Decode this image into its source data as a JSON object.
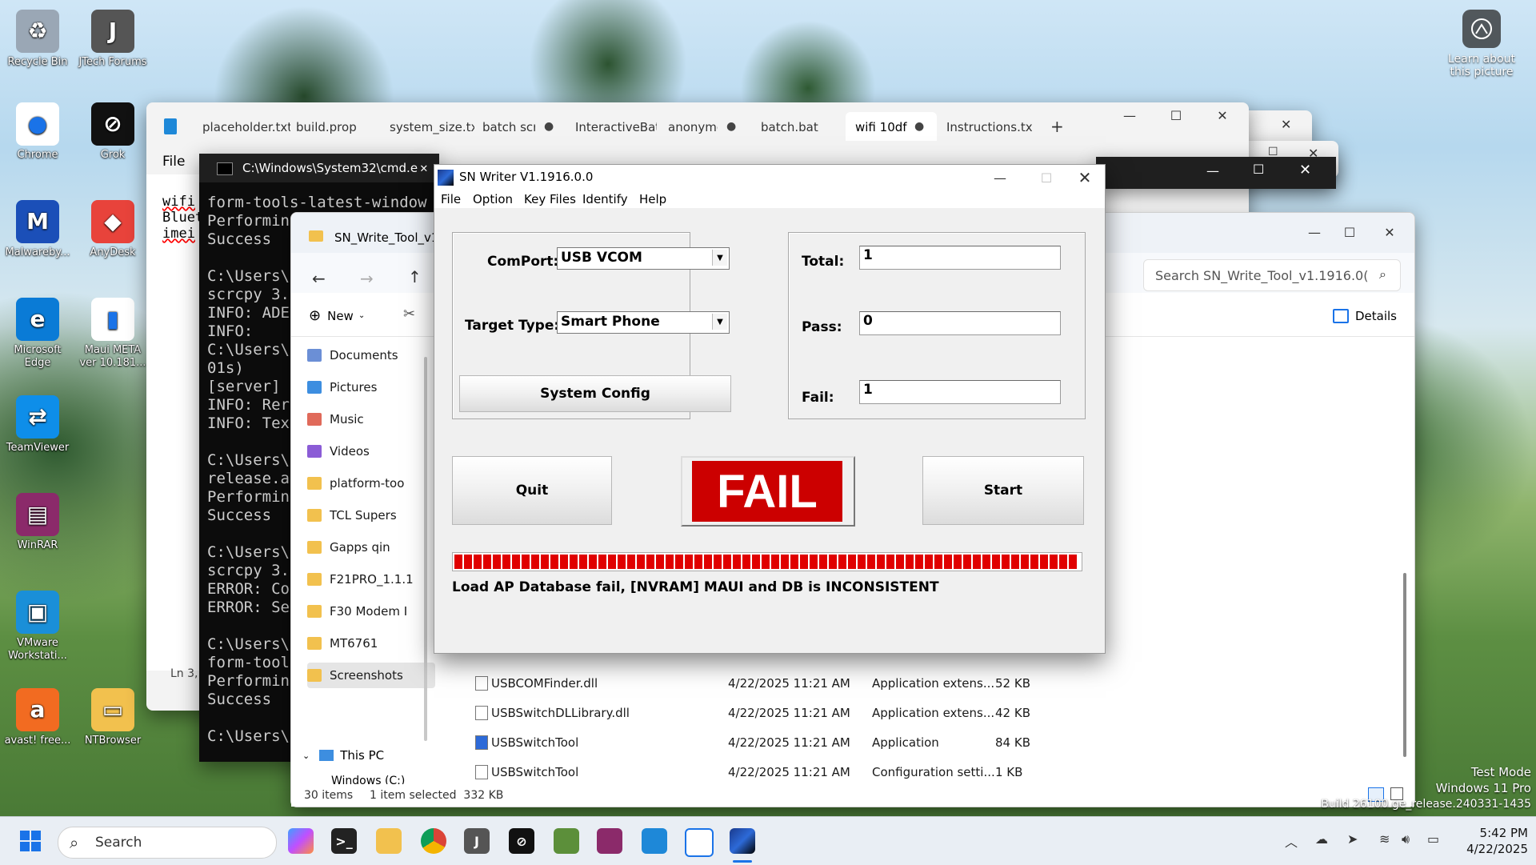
{
  "desktop": {
    "icons": [
      {
        "label": "Recycle Bin",
        "icon": "recycle-bin-icon"
      },
      {
        "label": "JTech Forums",
        "icon": "jtech-icon"
      },
      {
        "label": "Chrome",
        "icon": "chrome-icon"
      },
      {
        "label": "Grok",
        "icon": "grok-icon"
      },
      {
        "label": "Malwareby...",
        "icon": "malwarebytes-icon"
      },
      {
        "label": "AnyDesk",
        "icon": "anydesk-icon"
      },
      {
        "label": "Microsoft Edge",
        "icon": "edge-icon"
      },
      {
        "label": "Maui META ver 10.181...",
        "icon": "maui-meta-icon"
      },
      {
        "label": "TeamViewer",
        "icon": "teamviewer-icon"
      },
      {
        "label": "WinRAR",
        "icon": "winrar-icon"
      },
      {
        "label": "VMware Workstati...",
        "icon": "vmware-icon"
      },
      {
        "label": "avast! free...",
        "icon": "avast-icon"
      },
      {
        "label": "NTBrowser",
        "icon": "ntbrowser-icon"
      }
    ],
    "learn_about": "Learn about this picture",
    "watermark": {
      "line1": "Test Mode",
      "line2": "Windows 11 Pro",
      "line3": "Build 26100.ge_release.240331-1435"
    }
  },
  "notepad": {
    "tabs": [
      "placeholder.txt",
      "build.prop",
      "system_size.txt",
      "batch scr",
      "InteractiveBatc",
      "anonymc",
      "batch.bat",
      "wifi 10df",
      "Instructions.txt"
    ],
    "new_tab": "+",
    "menu_file": "File",
    "lines": [
      "wifi",
      "Bluet",
      "imei"
    ],
    "status": "Ln 3,"
  },
  "cmd": {
    "title": "C:\\Windows\\System32\\cmd.e",
    "lines": [
      "form-tools-latest-window",
      "Performin",
      "Success",
      "",
      "C:\\Users\\",
      "scrcpy 3.",
      "INFO: ADE",
      "INFO:",
      "C:\\Users\\",
      "01s)",
      "[server]",
      "INFO: Rer",
      "INFO: Tex",
      "",
      "C:\\Users\\",
      "release.a",
      "Performin",
      "Success",
      "",
      "C:\\Users\\",
      "scrcpy 3.",
      "ERROR: Co",
      "ERROR: Se",
      "",
      "C:\\Users\\",
      "form-tool",
      "Performin",
      "Success",
      "",
      "C:\\Users\\"
    ]
  },
  "explorer": {
    "tab_title": "SN_Write_Tool_v1.",
    "search_placeholder": "Search SN_Write_Tool_v1.1916.0(",
    "new_label": "New",
    "details_label": "Details",
    "nav": [
      {
        "label": "Documents",
        "color": "#6b8fd6"
      },
      {
        "label": "Pictures",
        "color": "#3d8ee0"
      },
      {
        "label": "Music",
        "color": "#e06a5a"
      },
      {
        "label": "Videos",
        "color": "#8b5cd6"
      },
      {
        "label": "platform-too",
        "color": "#f2c14e"
      },
      {
        "label": "TCL Supers",
        "color": "#f2c14e"
      },
      {
        "label": "Gapps qin",
        "color": "#f2c14e"
      },
      {
        "label": "F21PRO_1.1.1",
        "color": "#f2c14e"
      },
      {
        "label": "F30 Modem I",
        "color": "#f2c14e"
      },
      {
        "label": "MT6761",
        "color": "#f2c14e"
      },
      {
        "label": "Screenshots",
        "color": "#f2c14e"
      }
    ],
    "this_pc": "This PC",
    "windows_c": "Windows (C:)",
    "files": [
      {
        "name": "USBCOMFinder.dll",
        "date": "4/22/2025 11:21 AM",
        "type": "Application extens...",
        "size": "52 KB"
      },
      {
        "name": "USBSwitchDLLibrary.dll",
        "date": "4/22/2025 11:21 AM",
        "type": "Application extens...",
        "size": "42 KB"
      },
      {
        "name": "USBSwitchTool",
        "date": "4/22/2025 11:21 AM",
        "type": "Application",
        "size": "84 KB"
      },
      {
        "name": "USBSwitchTool",
        "date": "4/22/2025 11:21 AM",
        "type": "Configuration setti...",
        "size": "1 KB"
      }
    ],
    "status_items": "30 items",
    "status_selected": "1 item selected  332 KB"
  },
  "snwriter": {
    "title": "SN Writer V1.1916.0.0",
    "menu": [
      "File",
      "Option",
      "Key Files",
      "Identify",
      "Help"
    ],
    "comport_label": "ComPort:",
    "comport_value": "USB VCOM",
    "target_label": "Target Type:",
    "target_value": "Smart Phone",
    "system_config": "System Config",
    "total_label": "Total:",
    "total_value": "1",
    "pass_label": "Pass:",
    "pass_value": "0",
    "fail_label": "Fail:",
    "fail_value": "1",
    "quit": "Quit",
    "status_badge": "FAIL",
    "start": "Start",
    "progress": 1.0,
    "message": "Load AP Database fail, [NVRAM] MAUI and DB is INCONSISTENT",
    "colors": {
      "fail": "#cc0000",
      "progress": "#e00000"
    }
  },
  "taskbar": {
    "search_label": "Search",
    "time": "5:42 PM",
    "date": "4/22/2025"
  }
}
